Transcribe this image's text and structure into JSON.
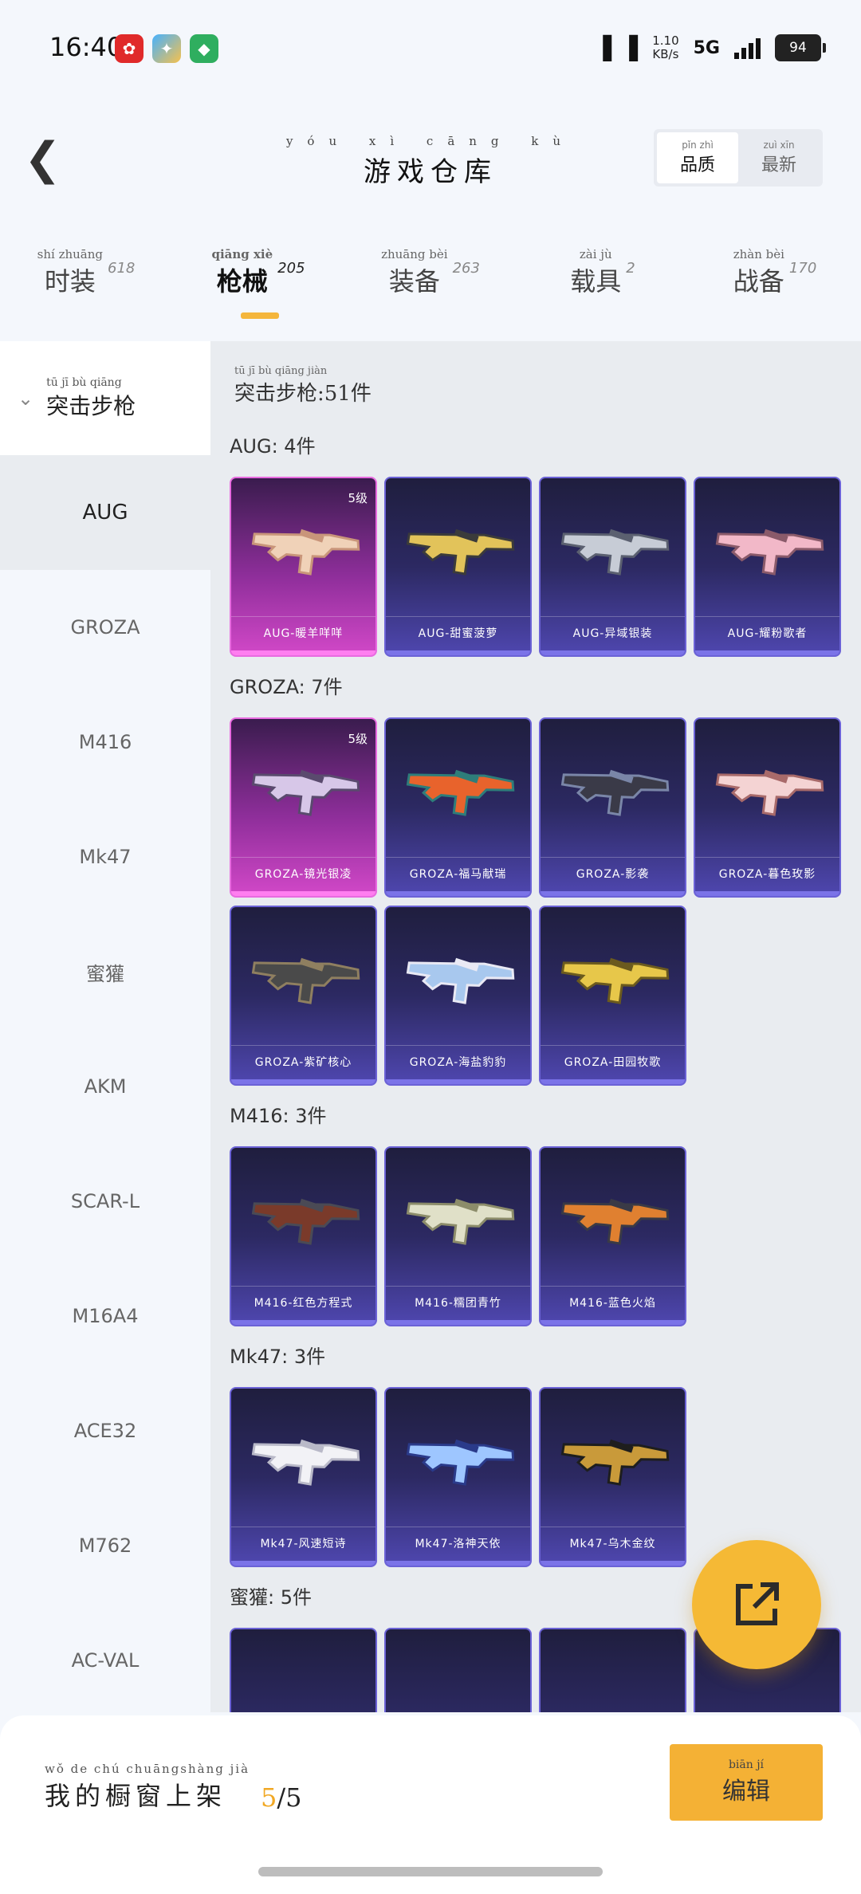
{
  "status": {
    "time": "16:40",
    "speed_value": "1.10",
    "speed_unit": "KB/s",
    "network": "5G",
    "battery": "94"
  },
  "header": {
    "title": "游戏仓库",
    "title_pinyin": "yóu xì cāng kù",
    "sort": [
      {
        "label": "品质",
        "pinyin": "pǐn zhì"
      },
      {
        "label": "最新",
        "pinyin": "zuì xīn"
      }
    ]
  },
  "tabs": [
    {
      "label": "时装",
      "pinyin": "shí zhuāng",
      "count": "618"
    },
    {
      "label": "枪械",
      "pinyin": "qiāng xiè",
      "count": "205"
    },
    {
      "label": "装备",
      "pinyin": "zhuāng bèi",
      "count": "263"
    },
    {
      "label": "载具",
      "pinyin": "zài jù",
      "count": "2"
    },
    {
      "label": "战备",
      "pinyin": "zhàn bèi",
      "count": "170"
    }
  ],
  "sidebar": {
    "header": {
      "label": "突击步枪",
      "pinyin": "tū jī bù qiāng"
    },
    "items": [
      "AUG",
      "GROZA",
      "M416",
      "Mk47",
      "蜜獾",
      "AKM",
      "SCAR-L",
      "M16A4",
      "ACE32",
      "M762",
      "AC-VAL"
    ]
  },
  "summary": {
    "text": "突击步枪:51件",
    "pinyin": "tū jī bù qiāng jiàn"
  },
  "groups": [
    {
      "title": "AUG: 4件",
      "cards": [
        {
          "name": "AUG-暖羊咩咩",
          "level": "5级"
        },
        {
          "name": "AUG-甜蜜菠萝"
        },
        {
          "name": "AUG-异域银装"
        },
        {
          "name": "AUG-耀粉歌者"
        }
      ]
    },
    {
      "title": "GROZA: 7件",
      "cards": [
        {
          "name": "GROZA-镜光银凌",
          "level": "5级"
        },
        {
          "name": "GROZA-福马献瑞"
        },
        {
          "name": "GROZA-影袭"
        },
        {
          "name": "GROZA-暮色玫影"
        },
        {
          "name": "GROZA-紫矿核心"
        },
        {
          "name": "GROZA-海盐豹豹"
        },
        {
          "name": "GROZA-田园牧歌"
        }
      ]
    },
    {
      "title": "M416: 3件",
      "cards": [
        {
          "name": "M416-红色方程式"
        },
        {
          "name": "M416-糯团青竹"
        },
        {
          "name": "M416-蓝色火焰"
        }
      ]
    },
    {
      "title": "Mk47: 3件",
      "cards": [
        {
          "name": "Mk47-风速短诗"
        },
        {
          "name": "Mk47-洛神天依"
        },
        {
          "name": "Mk47-乌木金纹"
        }
      ]
    },
    {
      "title": "蜜獾: 5件",
      "cards": []
    }
  ],
  "bottom": {
    "label": "我的橱窗上架",
    "pinyin": "wǒ de chú chuāngshàng jià",
    "current": "5",
    "total": "/5",
    "edit": "编辑",
    "edit_pinyin": "biān jí"
  },
  "colors": {
    "accent": "#f4b135",
    "card_blue": "#4f47b0",
    "card_pink": "#d248c8"
  }
}
